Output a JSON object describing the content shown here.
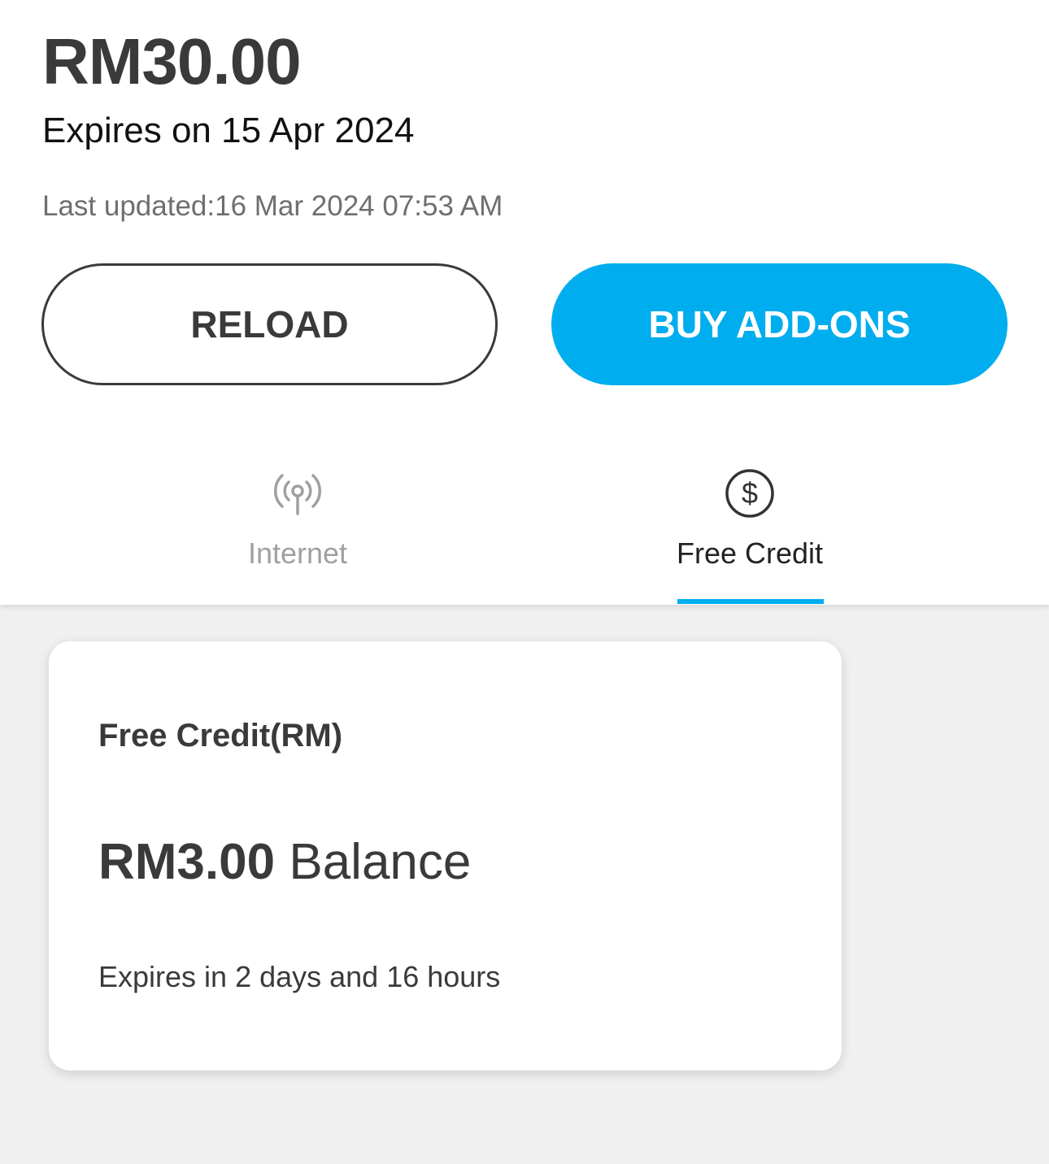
{
  "account": {
    "balance": "RM30.00",
    "expires": "Expires on 15 Apr 2024",
    "last_updated": "Last updated:16 Mar 2024 07:53 AM"
  },
  "actions": {
    "reload_label": "RELOAD",
    "buy_addons_label": "BUY ADD-ONS"
  },
  "tabs": [
    {
      "label": "Internet",
      "icon": "signal-antenna-icon",
      "selected": false
    },
    {
      "label": "Free Credit",
      "icon": "dollar-circle-icon",
      "selected": true
    }
  ],
  "card": {
    "title": "Free Credit(RM)",
    "amount": "RM3.00",
    "amount_suffix": "Balance",
    "expiry": "Expires in 2 days and 16 hours"
  },
  "colors": {
    "accent": "#00adee",
    "text_dark": "#3a3a3a",
    "background": "#f0f0f0"
  }
}
